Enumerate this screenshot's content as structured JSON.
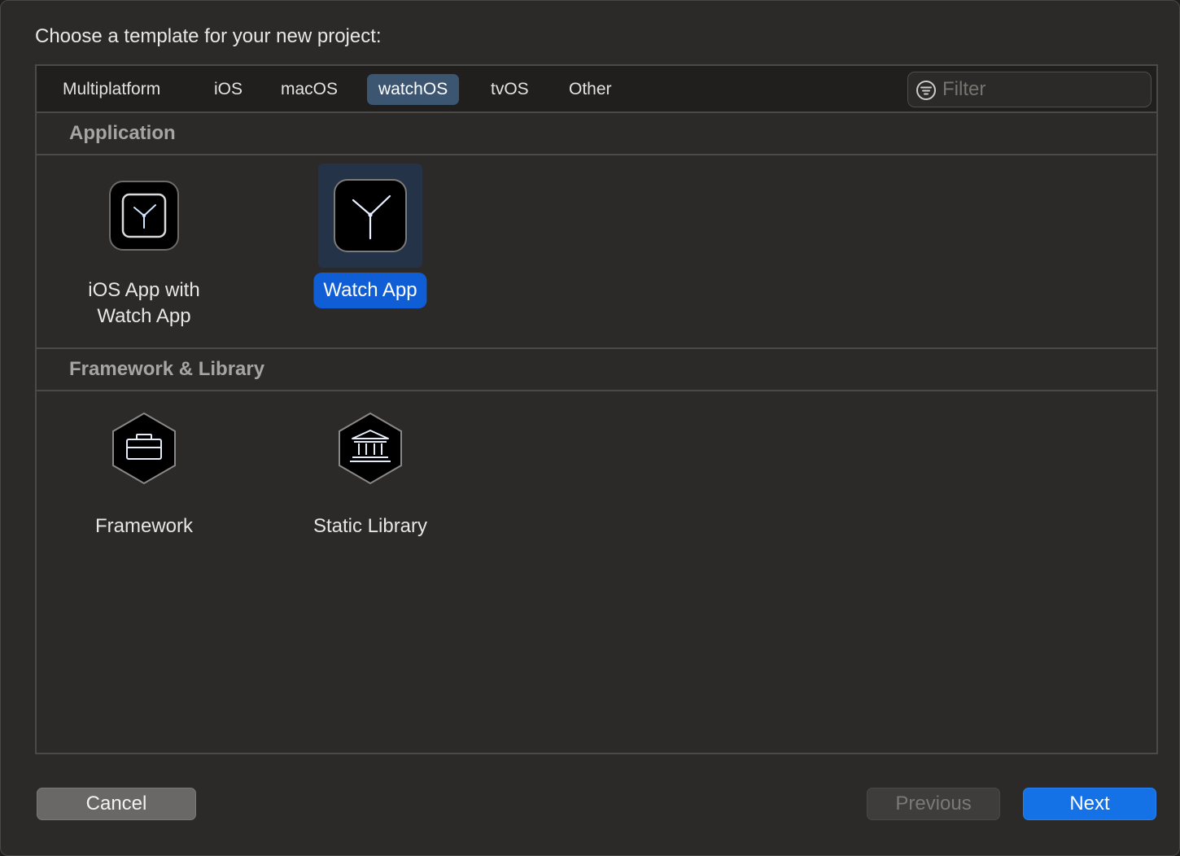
{
  "dialog": {
    "prompt": "Choose a template for your new project:"
  },
  "tabs": [
    {
      "label": "Multiplatform",
      "active": false
    },
    {
      "label": "iOS",
      "active": false
    },
    {
      "label": "macOS",
      "active": false
    },
    {
      "label": "watchOS",
      "active": true
    },
    {
      "label": "tvOS",
      "active": false
    },
    {
      "label": "Other",
      "active": false
    }
  ],
  "filter": {
    "placeholder": "Filter",
    "value": "",
    "icon": "filter-icon"
  },
  "sections": [
    {
      "title": "Application",
      "templates": [
        {
          "label_line1": "iOS App with",
          "label_line2": "Watch App",
          "icon": "watch-app-icon",
          "selected": false
        },
        {
          "label": "Watch App",
          "icon": "watch-app-icon",
          "selected": true
        }
      ]
    },
    {
      "title": "Framework & Library",
      "templates": [
        {
          "label": "Framework",
          "icon": "toolbox-hexagon-icon",
          "selected": false
        },
        {
          "label": "Static Library",
          "icon": "library-building-hexagon-icon",
          "selected": false
        }
      ]
    }
  ],
  "buttons": {
    "cancel": "Cancel",
    "previous": "Previous",
    "next": "Next",
    "previous_enabled": false
  },
  "colors": {
    "accent": "#1471e6",
    "selection": "#0f5ed6",
    "active_tab": "#3c5571",
    "background": "#2c2a29"
  }
}
